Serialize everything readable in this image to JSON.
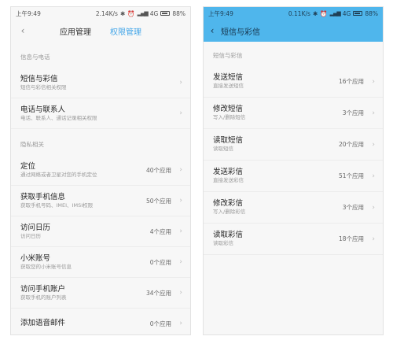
{
  "left": {
    "status": {
      "time": "上午9:49",
      "speed": "2.14K/s",
      "network": "4G",
      "battery": "88%"
    },
    "nav": {
      "tab_app": "应用管理",
      "tab_permission": "权限管理"
    },
    "section1": "信息与电话",
    "items1": [
      {
        "title": "短信与彩信",
        "sub": "短信与彩信相关权限",
        "count": ""
      },
      {
        "title": "电话与联系人",
        "sub": "电话、联系人、通话记录相关权限",
        "count": ""
      }
    ],
    "section2": "隐私相关",
    "items2": [
      {
        "title": "定位",
        "sub": "通过网络或者卫星对您的手机定位",
        "count": "40个应用"
      },
      {
        "title": "获取手机信息",
        "sub": "获取手机号码、IMEI、IMSI权限",
        "count": "50个应用"
      },
      {
        "title": "访问日历",
        "sub": "访问日历",
        "count": "4个应用"
      },
      {
        "title": "小米账号",
        "sub": "获取您的小米账号信息",
        "count": "0个应用"
      },
      {
        "title": "访问手机账户",
        "sub": "获取手机的账户列表",
        "count": "34个应用"
      },
      {
        "title": "添加语音邮件",
        "sub": "",
        "count": "0个应用"
      }
    ]
  },
  "right": {
    "status": {
      "time": "上午9:49",
      "speed": "0.11K/s",
      "network": "4G",
      "battery": "88%"
    },
    "nav": {
      "title": "短信与彩信"
    },
    "section": "短信与彩信",
    "items": [
      {
        "title": "发送短信",
        "sub": "直接发送短信",
        "count": "16个应用"
      },
      {
        "title": "修改短信",
        "sub": "写入/删除短信",
        "count": "3个应用"
      },
      {
        "title": "读取短信",
        "sub": "读取短信",
        "count": "20个应用"
      },
      {
        "title": "发送彩信",
        "sub": "直接发送彩信",
        "count": "51个应用"
      },
      {
        "title": "修改彩信",
        "sub": "写入/删除彩信",
        "count": "3个应用"
      },
      {
        "title": "读取彩信",
        "sub": "读取彩信",
        "count": "18个应用"
      }
    ]
  },
  "icons": {
    "back": "back-arrow-icon",
    "chevron": "chevron-right-icon"
  },
  "colors": {
    "accent": "#43a6e8",
    "header_blue": "#4fb6ec"
  }
}
